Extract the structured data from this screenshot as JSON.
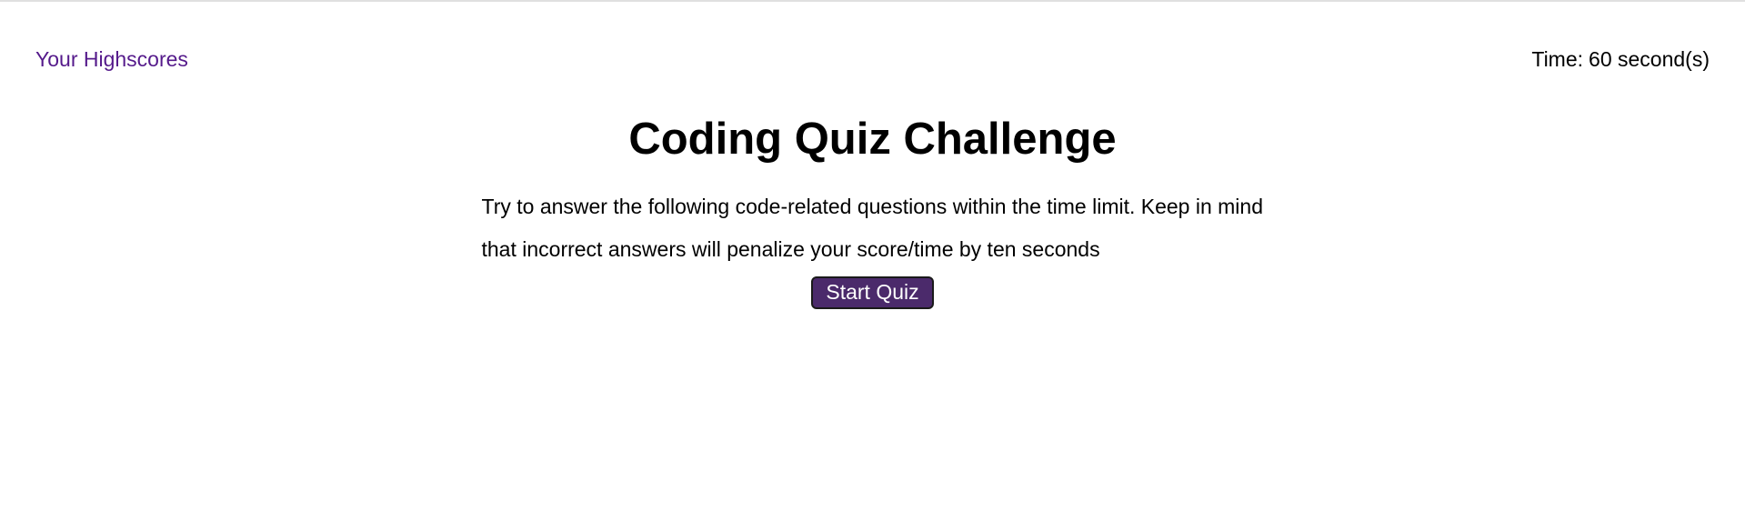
{
  "header": {
    "highscores_link": "Your Highscores",
    "timer_label": "Time:",
    "timer_value": "60 second(s)"
  },
  "main": {
    "title": "Coding Quiz Challenge",
    "instructions": "Try to answer the following code-related questions within the time limit. Keep in mind that incorrect answers will penalize your score/time by ten seconds",
    "start_button": "Start Quiz"
  },
  "colors": {
    "link": "#551a8b",
    "button_bg": "#4b2a6b",
    "button_text": "#ffffff"
  }
}
